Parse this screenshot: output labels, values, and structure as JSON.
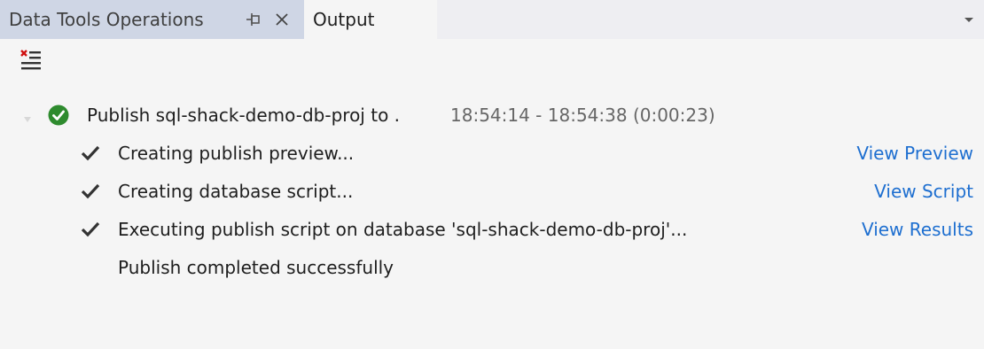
{
  "tabs": {
    "data_tools": "Data Tools Operations",
    "output": "Output"
  },
  "icons": {
    "pin": "pin-icon",
    "close": "close-icon",
    "overflow": "chevron-down-icon",
    "clear": "clear-all-icon",
    "success": "success-check-icon",
    "check": "checkmark-icon"
  },
  "colors": {
    "success": "#2e8b2e",
    "clear_x": "#d01010",
    "link": "#1e6fd0"
  },
  "operation": {
    "title": "Publish sql-shack-demo-db-proj to .",
    "time_range": "18:54:14 - 18:54:38 (0:00:23)",
    "steps": [
      {
        "text": "Creating publish preview...",
        "link": "View Preview",
        "done": true
      },
      {
        "text": "Creating database script...",
        "link": "View Script",
        "done": true
      },
      {
        "text": "Executing publish script on database 'sql-shack-demo-db-proj'...",
        "link": "View Results",
        "done": true
      },
      {
        "text": "Publish completed successfully",
        "link": "",
        "done": false
      }
    ]
  }
}
